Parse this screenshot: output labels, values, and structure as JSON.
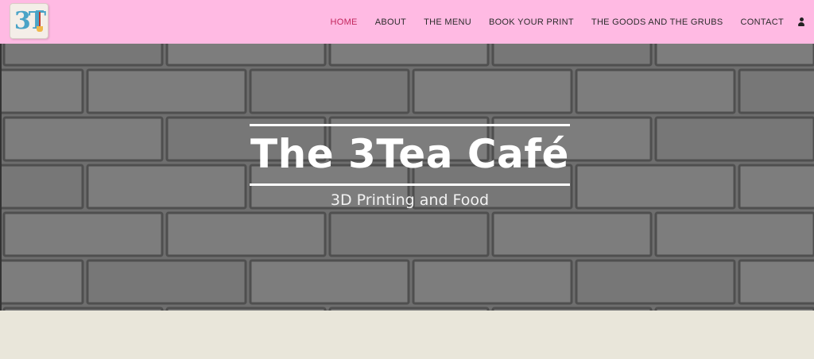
{
  "nav": {
    "items": [
      {
        "label": "HOME",
        "active": true
      },
      {
        "label": "ABOUT"
      },
      {
        "label": "THE MENU"
      },
      {
        "label": "BOOK YOUR PRINT"
      },
      {
        "label": "THE GOODS AND THE GRUBS"
      },
      {
        "label": "CONTACT"
      }
    ],
    "user_icon": "user-icon"
  },
  "logo": {
    "mark": "3T"
  },
  "hero": {
    "title": "The 3Tea Café",
    "subtitle": "3D Printing and Food"
  },
  "colors": {
    "header_bg": "#ffbae3",
    "nav_active": "#c2255c",
    "hero_bg": "#6f6f6f",
    "footer_bg": "#e9e6da"
  }
}
